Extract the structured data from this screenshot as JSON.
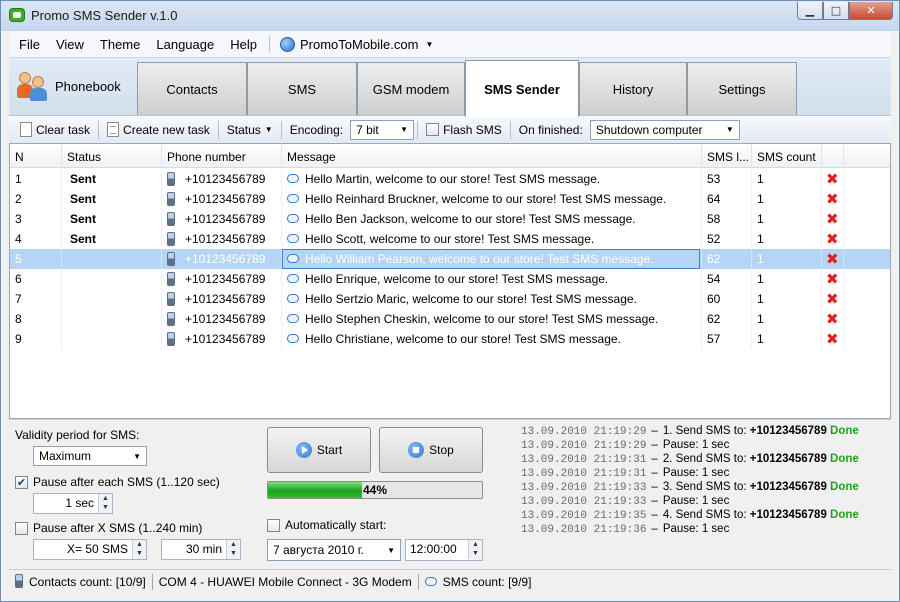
{
  "window": {
    "title": "Promo SMS Sender v.1.0"
  },
  "menu": {
    "items": [
      "File",
      "View",
      "Theme",
      "Language",
      "Help"
    ],
    "promo": "PromoToMobile.com"
  },
  "tabs": {
    "phonebook": "Phonebook",
    "items": [
      "Contacts",
      "SMS",
      "GSM modem",
      "SMS Sender",
      "History",
      "Settings"
    ],
    "active": "SMS Sender"
  },
  "toolbar": {
    "clear_task": "Clear task",
    "create_new_task": "Create new task",
    "status": "Status",
    "encoding_label": "Encoding:",
    "encoding_value": "7 bit",
    "flash_sms": "Flash SMS",
    "on_finished_label": "On finished:",
    "on_finished_value": "Shutdown computer"
  },
  "grid": {
    "columns": [
      "N",
      "Status",
      "Phone number",
      "Message",
      "SMS l...",
      "SMS count"
    ],
    "rows": [
      {
        "n": "1",
        "status": "Sent",
        "phone": "+10123456789",
        "message": "Hello Martin, welcome to our store! Test SMS message.",
        "len": "53",
        "count": "1"
      },
      {
        "n": "2",
        "status": "Sent",
        "phone": "+10123456789",
        "message": "Hello Reinhard Bruckner, welcome to our store! Test SMS message.",
        "len": "64",
        "count": "1"
      },
      {
        "n": "3",
        "status": "Sent",
        "phone": "+10123456789",
        "message": "Hello Ben Jackson, welcome to our store! Test SMS message.",
        "len": "58",
        "count": "1"
      },
      {
        "n": "4",
        "status": "Sent",
        "phone": "+10123456789",
        "message": "Hello Scott, welcome to our store! Test SMS message.",
        "len": "52",
        "count": "1"
      },
      {
        "n": "5",
        "status": "",
        "phone": "+10123456789",
        "message": "Hello William Pearson, welcome to our store! Test SMS message.",
        "len": "62",
        "count": "1"
      },
      {
        "n": "6",
        "status": "",
        "phone": "+10123456789",
        "message": "Hello Enrique, welcome to our store! Test SMS message.",
        "len": "54",
        "count": "1"
      },
      {
        "n": "7",
        "status": "",
        "phone": "+10123456789",
        "message": "Hello Sertzio Maric, welcome to our store! Test SMS message.",
        "len": "60",
        "count": "1"
      },
      {
        "n": "8",
        "status": "",
        "phone": "+10123456789",
        "message": "Hello Stephen Cheskin, welcome to our store! Test SMS message.",
        "len": "62",
        "count": "1"
      },
      {
        "n": "9",
        "status": "",
        "phone": "+10123456789",
        "message": "Hello Christiane, welcome to our store! Test SMS message.",
        "len": "57",
        "count": "1"
      }
    ],
    "selected_row": 5
  },
  "settings": {
    "validity_label": "Validity period for SMS:",
    "validity_value": "Maximum",
    "pause_each_label": "Pause after each SMS (1..120 sec)",
    "pause_each_checked": true,
    "pause_each_value": "1 sec",
    "pause_x_label": "Pause after X SMS (1..240 min)",
    "pause_x_checked": false,
    "pause_x_count": "X= 50 SMS",
    "pause_x_minutes": "30 min",
    "auto_start_label": "Automatically start:",
    "auto_start_checked": false,
    "auto_start_date": "7 августа  2010 г.",
    "auto_start_time": "12:00:00"
  },
  "controls": {
    "start": "Start",
    "stop": "Stop",
    "progress_text": "44%",
    "progress_percent": 44
  },
  "log": [
    {
      "ts": "13.09.2010 21:19:29",
      "sep": "–",
      "text": "1. Send SMS to: ",
      "phone": "+10123456789",
      "status": "Done"
    },
    {
      "ts": "13.09.2010 21:19:29",
      "sep": "–",
      "text": "Pause: 1 sec",
      "phone": "",
      "status": ""
    },
    {
      "ts": "13.09.2010 21:19:31",
      "sep": "–",
      "text": "2. Send SMS to: ",
      "phone": "+10123456789",
      "status": "Done"
    },
    {
      "ts": "13.09.2010 21:19:31",
      "sep": "–",
      "text": "Pause: 1 sec",
      "phone": "",
      "status": ""
    },
    {
      "ts": "13.09.2010 21:19:33",
      "sep": "–",
      "text": "3. Send SMS to: ",
      "phone": "+10123456789",
      "status": "Done"
    },
    {
      "ts": "13.09.2010 21:19:33",
      "sep": "–",
      "text": "Pause: 1 sec",
      "phone": "",
      "status": ""
    },
    {
      "ts": "13.09.2010 21:19:35",
      "sep": "–",
      "text": "4. Send SMS to: ",
      "phone": "+10123456789",
      "status": "Done"
    },
    {
      "ts": "13.09.2010 21:19:36",
      "sep": "–",
      "text": "Pause: 1 sec",
      "phone": "",
      "status": ""
    }
  ],
  "statusbar": {
    "contacts": "Contacts count: [10/9]",
    "modem": "COM 4 - HUAWEI Mobile Connect - 3G Modem",
    "sms": "SMS count: [9/9]"
  },
  "colors": {
    "selection": "#b6d5f6",
    "done": "#1ea51a",
    "delete": "#e02222",
    "progress": "#16a31a"
  },
  "icons": {
    "row_phone": "phone-icon",
    "row_message": "message-icon",
    "row_delete": "delete-icon"
  }
}
